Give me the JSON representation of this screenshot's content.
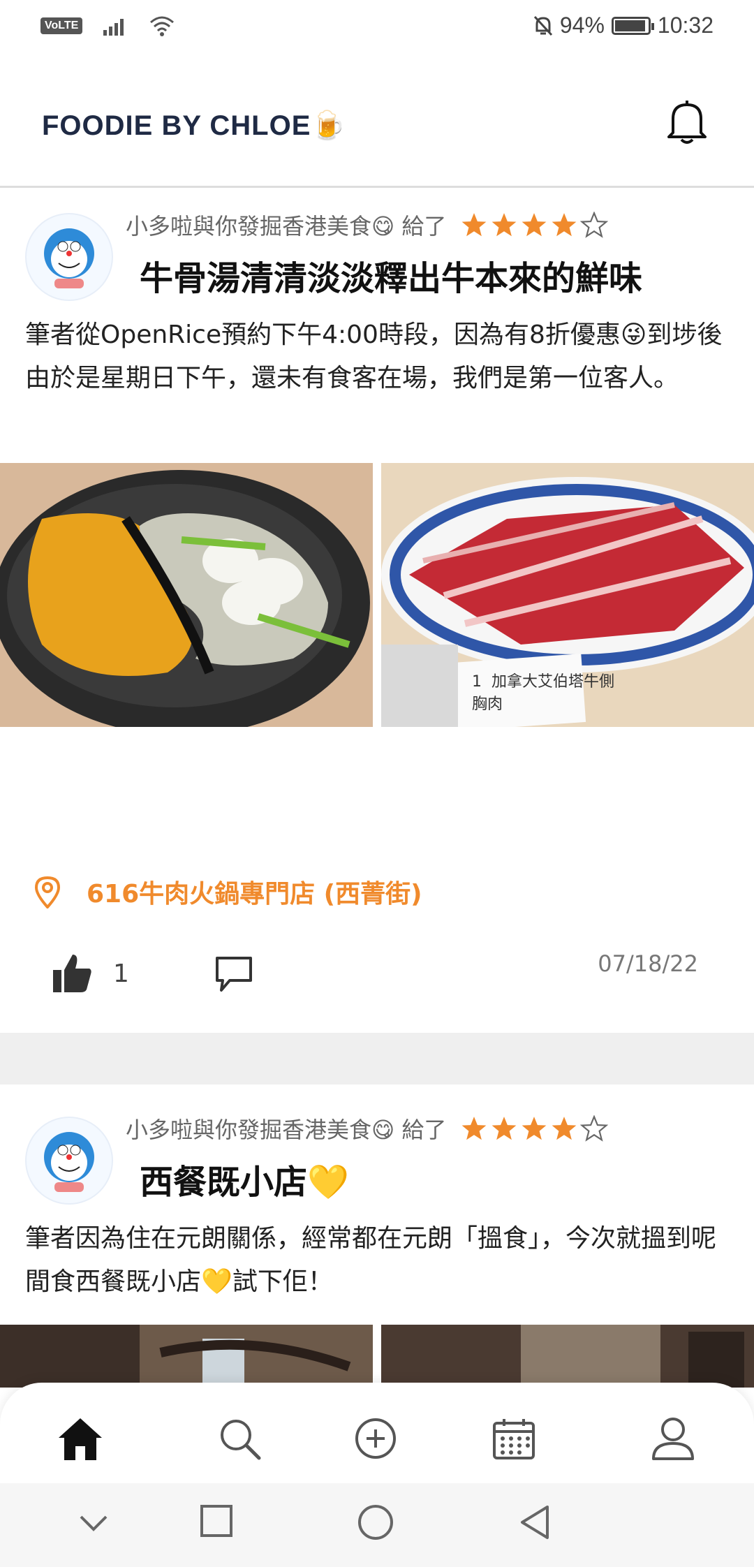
{
  "status_bar": {
    "volte": "VoLTE",
    "battery_percent": "94%",
    "battery_level": 0.94,
    "time": "10:32"
  },
  "header": {
    "title": "FOODIE BY CHLOE🍺"
  },
  "posts": [
    {
      "author": "小多啦與你發掘香港美食😋",
      "gave": "給了",
      "rating": 4,
      "rating_max": 5,
      "title": "牛骨湯清清淡淡釋出牛本來的鮮味",
      "body": " 筆者從OpenRice預約下午4:00時段，因為有8折優惠😜到埗後由於是星期日下午，還未有食客在場，我們是第一位客人。",
      "location": "616牛肉火鍋專門店 (西菁街)",
      "likes": "1",
      "date": "07/18/22",
      "photo_text": [
        "1",
        "加拿大艾伯塔牛側",
        "胸肉"
      ]
    },
    {
      "author": "小多啦與你發掘香港美食😋",
      "gave": "給了",
      "rating": 4,
      "rating_max": 5,
      "title": "西餐既小店💛",
      "body": " 筆者因為住在元朗關係，經常都在元朗「搵食」，今次就搵到呢間食西餐既小店💛試下佢！"
    }
  ],
  "colors": {
    "accent": "#f08a2c",
    "star": "#f08a2c",
    "title": "#1f2a44"
  },
  "bottom_nav": [
    "home-icon",
    "search-icon",
    "add-icon",
    "calendar-icon",
    "profile-icon"
  ],
  "system_nav": [
    "chevron-down-icon",
    "recents-icon",
    "home-circle-icon",
    "back-icon"
  ]
}
